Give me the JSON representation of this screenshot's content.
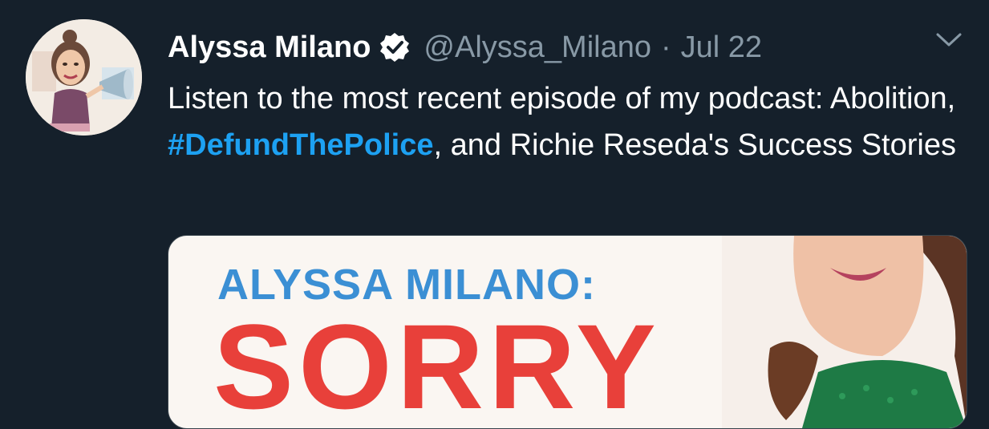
{
  "tweet": {
    "author_name": "Alyssa Milano",
    "handle": "@Alyssa_Milano",
    "separator": "·",
    "date": "Jul 22",
    "text_before": "Listen to the most recent episode of my podcast: Abolition, ",
    "hashtag": "#DefundThePolice",
    "text_after": ", and Richie Reseda's Success Stories"
  },
  "card": {
    "line1": "ALYSSA MILANO:",
    "line2": "SORRY"
  },
  "icons": {
    "verified": "verified-badge-icon",
    "caret": "chevron-down-icon"
  },
  "colors": {
    "background": "#15202b",
    "secondary_text": "#8899a6",
    "link": "#1da1f2",
    "card_title_blue": "#3b8fd4",
    "card_title_red": "#e8403a"
  }
}
